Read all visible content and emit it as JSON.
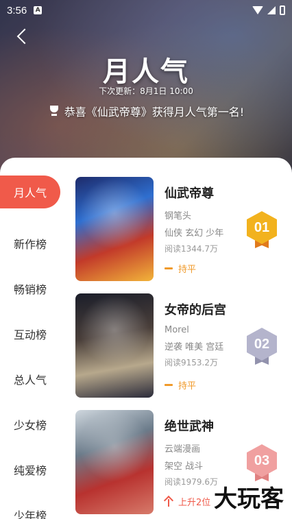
{
  "status": {
    "time": "3:56",
    "app_badge": "A"
  },
  "header": {
    "title": "月人气",
    "next_update": "下次更新：8月1日 10:00",
    "congrats": "恭喜《仙武帝尊》获得月人气第一名!"
  },
  "sidebar": {
    "items": [
      {
        "label": "月人气"
      },
      {
        "label": "新作榜"
      },
      {
        "label": "畅销榜"
      },
      {
        "label": "互动榜"
      },
      {
        "label": "总人气"
      },
      {
        "label": "少女榜"
      },
      {
        "label": "纯爱榜"
      },
      {
        "label": "少年榜"
      }
    ],
    "active_index": 0
  },
  "rankings": [
    {
      "rank": "01",
      "title": "仙武帝尊",
      "author": "钢笔头",
      "tags": "仙侠 玄幻 少年",
      "reads": "阅读1344.7万",
      "trend": "持平",
      "trend_type": "flat"
    },
    {
      "rank": "02",
      "title": "女帝的后宫",
      "author": "Morel",
      "tags": "逆袭 唯美 宫廷",
      "reads": "阅读9153.2万",
      "trend": "持平",
      "trend_type": "flat"
    },
    {
      "rank": "03",
      "title": "绝世武神",
      "author": "云端漫画",
      "tags": "架空 战斗",
      "reads": "阅读1979.6万",
      "trend": "上升2位",
      "trend_type": "up"
    }
  ],
  "watermark": "大玩客",
  "colors": {
    "accent": "#f05a4a",
    "gold": "#f2b21e",
    "silver": "#b4b4cc",
    "bronze": "#f0a0a0",
    "trend_flat": "#f09a2a"
  }
}
